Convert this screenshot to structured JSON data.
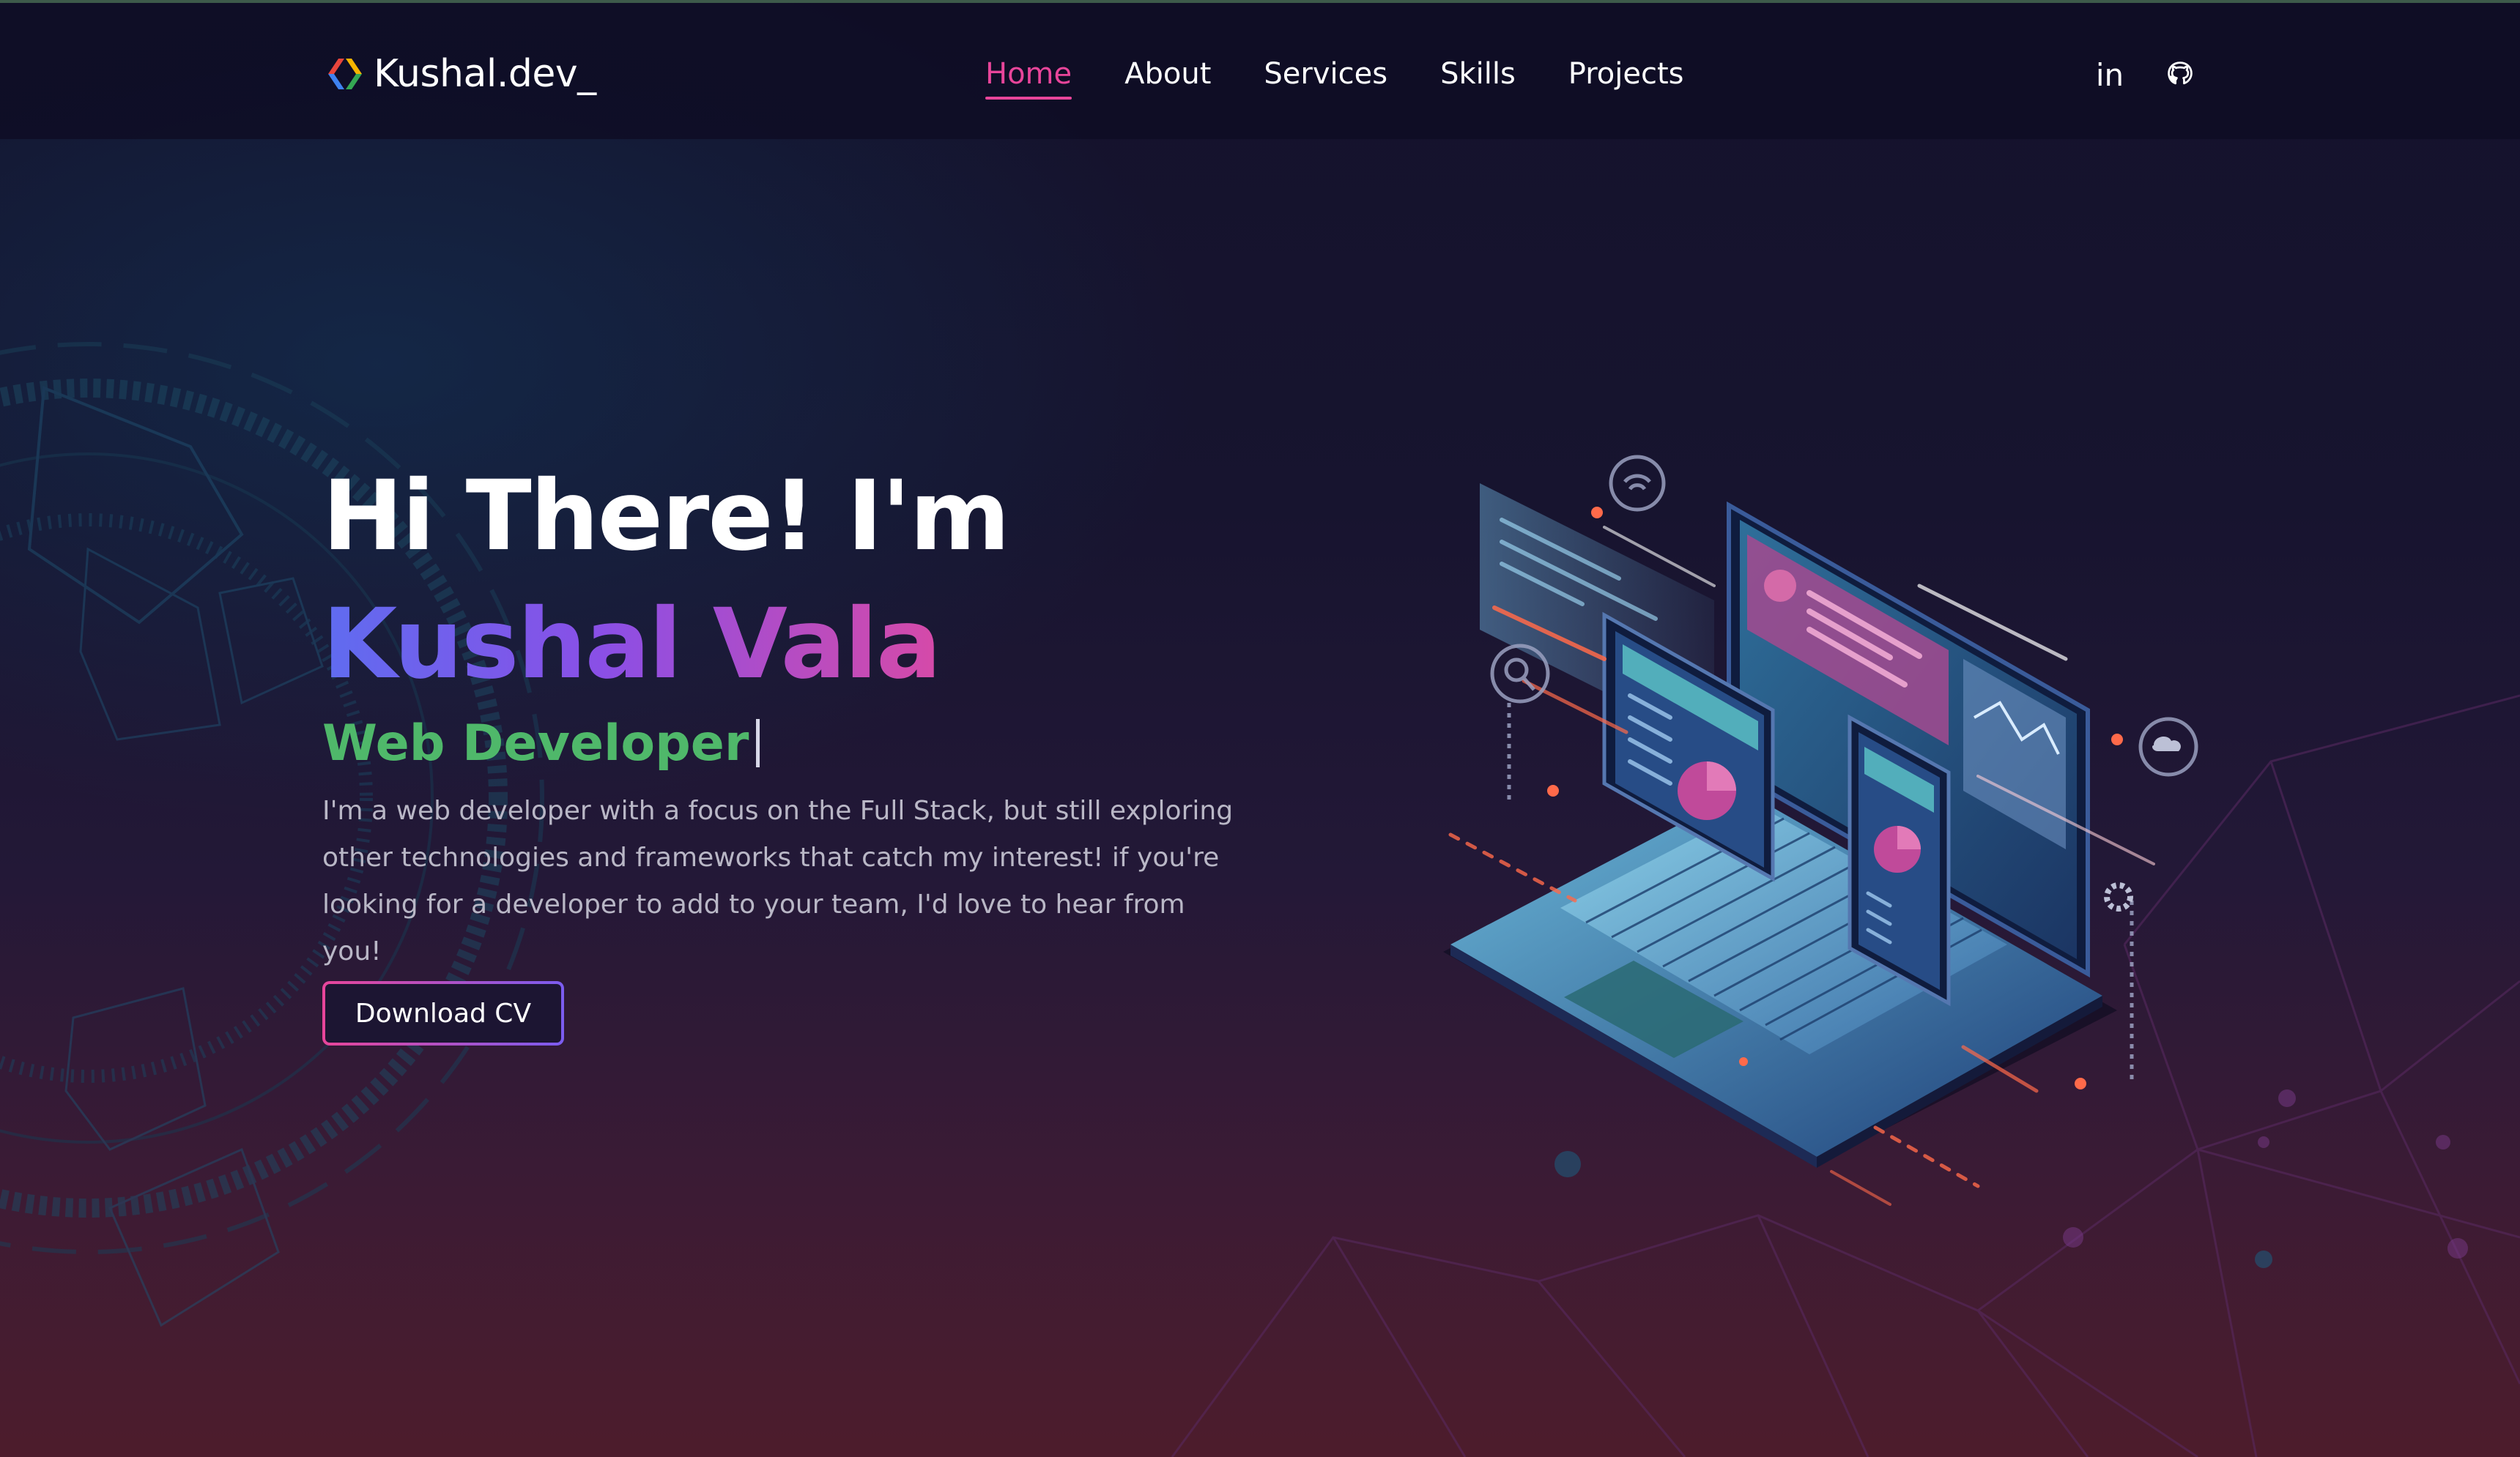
{
  "logo": {
    "text": "Kushal.dev_",
    "icon": "code-brackets-icon"
  },
  "nav": {
    "items": [
      {
        "label": "Home",
        "active": true
      },
      {
        "label": "About",
        "active": false
      },
      {
        "label": "Services",
        "active": false
      },
      {
        "label": "Skills",
        "active": false
      },
      {
        "label": "Projects",
        "active": false
      }
    ]
  },
  "social": {
    "linkedin_label": "in",
    "linkedin_icon": "linkedin-icon",
    "github_icon": "github-icon"
  },
  "hero": {
    "greeting": "Hi There! I'm",
    "name": "Kushal Vala",
    "role": "Web Developer",
    "description": "I'm a web developer with a focus on the Full Stack, but still exploring other technologies and frameworks that catch my interest! if you're looking for a developer to add to your team, I'd love to hear from you!",
    "cta_label": "Download CV",
    "illustration_icon": "laptop-devices-illustration"
  },
  "colors": {
    "accent_pink": "#e8459a",
    "accent_purple": "#7b5cf0",
    "role_green": "#4fb86a",
    "background": "#15132c"
  }
}
